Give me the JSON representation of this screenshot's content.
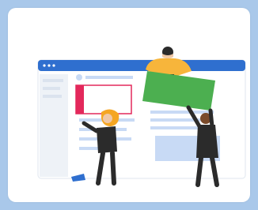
{
  "illustration": {
    "name": "website-collaboration-illustration",
    "colors": {
      "background": "#a9c8ea",
      "card": "#ffffff",
      "browser_bar": "#2f6fcf",
      "sidebar": "#eaeef3",
      "content_line": "#c8daf5",
      "accent_red": "#e3285b",
      "accent_green": "#4caf50",
      "accent_orange": "#f5a623",
      "accent_yellow": "#f7b53b",
      "dark": "#2b2b2b"
    }
  }
}
